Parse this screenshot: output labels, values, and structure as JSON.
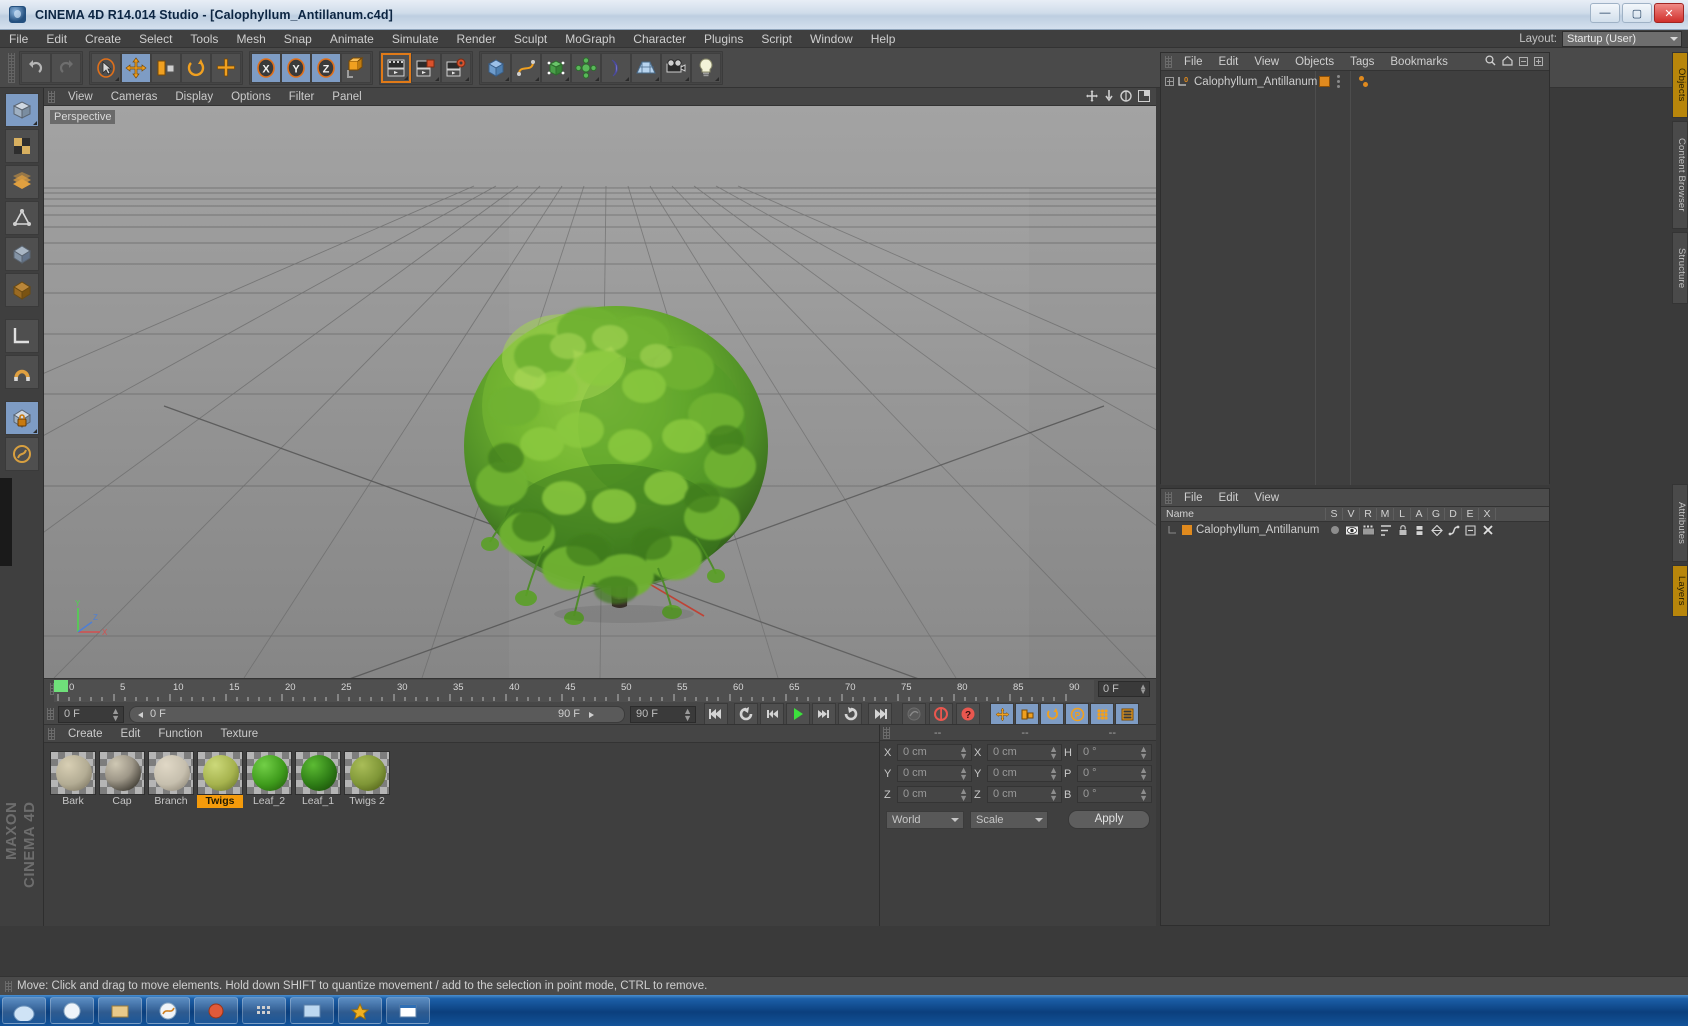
{
  "window": {
    "title": "CINEMA 4D R14.014 Studio - [Calophyllum_Antillanum.c4d]",
    "app_icon": "cinema4d-app-icon",
    "minimize": "—",
    "maximize": "▢",
    "close": "✕"
  },
  "menubar": {
    "items": [
      "File",
      "Edit",
      "Create",
      "Select",
      "Tools",
      "Mesh",
      "Snap",
      "Animate",
      "Simulate",
      "Render",
      "Sculpt",
      "MoGraph",
      "Character",
      "Plugins",
      "Script",
      "Window",
      "Help"
    ],
    "layout_label": "Layout:",
    "layout_value": "Startup (User)"
  },
  "toolbar": {
    "groups": [
      {
        "name": "history",
        "buttons": [
          {
            "icon": "undo-icon",
            "selected": false
          },
          {
            "icon": "redo-icon",
            "selected": false
          }
        ]
      },
      {
        "name": "tools",
        "buttons": [
          {
            "icon": "live-selection-icon",
            "selected": false
          },
          {
            "icon": "move-tool-icon",
            "selected": true
          },
          {
            "icon": "scale-tool-icon",
            "selected": false
          },
          {
            "icon": "rotate-tool-icon",
            "selected": false
          },
          {
            "icon": "add-tool-icon",
            "selected": false
          }
        ]
      },
      {
        "name": "axis-locks",
        "buttons": [
          {
            "icon": "x-axis-lock-icon",
            "selected": true
          },
          {
            "icon": "y-axis-lock-icon",
            "selected": true
          },
          {
            "icon": "z-axis-lock-icon",
            "selected": true
          },
          {
            "icon": "world-object-axis-icon",
            "selected": false
          }
        ]
      },
      {
        "name": "render",
        "buttons": [
          {
            "icon": "render-view-icon",
            "selected": false,
            "framed": true
          },
          {
            "icon": "render-region-icon",
            "selected": false
          },
          {
            "icon": "render-settings-icon",
            "selected": false
          }
        ]
      },
      {
        "name": "primitives",
        "buttons": [
          {
            "icon": "cube-primitive-icon",
            "selected": false
          },
          {
            "icon": "spline-pen-icon",
            "selected": false
          },
          {
            "icon": "nurbs-generator-icon",
            "selected": false
          },
          {
            "icon": "mograph-array-icon",
            "selected": false
          },
          {
            "icon": "deformer-bend-icon",
            "selected": false
          },
          {
            "icon": "scene-floor-icon",
            "selected": false
          },
          {
            "icon": "camera-icon",
            "selected": false
          },
          {
            "icon": "light-icon",
            "selected": false
          }
        ]
      }
    ]
  },
  "left_palette": {
    "buttons": [
      {
        "icon": "model-mode-icon",
        "selected": true
      },
      {
        "icon": "texture-mode-icon",
        "selected": false
      },
      {
        "icon": "points-mode-icon",
        "selected": false
      },
      {
        "icon": "edges-mode-icon",
        "selected": false
      },
      {
        "icon": "polygons-mode-icon",
        "selected": false
      },
      {
        "icon": "object-axis-mode-icon",
        "selected": false
      },
      {
        "icon": "workplane-icon",
        "selected": false
      },
      {
        "icon": "magnet-icon",
        "selected": false
      },
      {
        "icon": "enable-axis-icon",
        "selected": true
      },
      {
        "icon": "viewport-solo-icon",
        "selected": false
      }
    ],
    "brand_line1": "MAXON",
    "brand_line2": "CINEMA 4D"
  },
  "viewport": {
    "menu": [
      "View",
      "Cameras",
      "Display",
      "Options",
      "Filter",
      "Panel"
    ],
    "label": "Perspective",
    "corner_icons": [
      "pan-viewport-icon",
      "dolly-viewport-icon",
      "rotate-viewport-icon",
      "toggle-layout-icon"
    ],
    "axis": {
      "x": "X",
      "y": "Y",
      "z": "Z"
    }
  },
  "timeline": {
    "ticks": [
      "0",
      "5",
      "10",
      "15",
      "20",
      "25",
      "30",
      "35",
      "40",
      "45",
      "50",
      "55",
      "60",
      "65",
      "70",
      "75",
      "80",
      "85",
      "90"
    ],
    "current_frame_field": "0 F",
    "start_field": "0 F",
    "scrub_left": "0 F",
    "scrub_right": "90 F",
    "end_field": "90 F",
    "transport": [
      {
        "icon": "go-to-start-icon"
      },
      {
        "icon": "previous-key-icon"
      },
      {
        "icon": "step-back-icon"
      },
      {
        "icon": "play-icon"
      },
      {
        "icon": "step-forward-icon"
      },
      {
        "icon": "next-key-icon"
      },
      {
        "icon": "go-to-end-icon"
      }
    ],
    "record_tools": [
      {
        "icon": "autokey-icon",
        "selected": false
      },
      {
        "icon": "record-active-objects-icon",
        "selected": false
      },
      {
        "icon": "keyframe-selection-icon",
        "selected": false
      }
    ],
    "key_toggles": [
      {
        "icon": "key-position-icon",
        "selected": true
      },
      {
        "icon": "key-scale-icon",
        "selected": true
      },
      {
        "icon": "key-rotation-icon",
        "selected": true
      },
      {
        "icon": "key-parameter-icon",
        "selected": true
      },
      {
        "icon": "key-pla-icon",
        "selected": true
      },
      {
        "icon": "animation-layout-icon",
        "selected": true
      }
    ]
  },
  "material_manager": {
    "menu": [
      "Create",
      "Edit",
      "Function",
      "Texture"
    ],
    "materials": [
      {
        "name": "Bark",
        "color": "#b3ac94",
        "selected": false
      },
      {
        "name": "Cap",
        "color": "#9e9788",
        "selected": false
      },
      {
        "name": "Branch",
        "color": "#c6bfae",
        "selected": false
      },
      {
        "name": "Twigs",
        "color": "#a6b34e",
        "selected": true
      },
      {
        "name": "Leaf_2",
        "color": "#3f9c1c",
        "selected": false
      },
      {
        "name": "Leaf_1",
        "color": "#2e7d16",
        "selected": false
      },
      {
        "name": "Twigs 2",
        "color": "#7f9637",
        "selected": false
      }
    ]
  },
  "coordinates": {
    "headers": [
      "--",
      "--",
      "--"
    ],
    "rows": [
      {
        "label1": "X",
        "value1": "0 cm",
        "label2": "X",
        "value2": "0 cm",
        "label3": "H",
        "value3": "0 °"
      },
      {
        "label1": "Y",
        "value1": "0 cm",
        "label2": "Y",
        "value2": "0 cm",
        "label3": "P",
        "value3": "0 °"
      },
      {
        "label1": "Z",
        "value1": "0 cm",
        "label2": "Z",
        "value2": "0 cm",
        "label3": "B",
        "value3": "0 °"
      }
    ],
    "system_select": "World",
    "mode_select": "Scale",
    "apply_label": "Apply"
  },
  "object_manager": {
    "menu": [
      "File",
      "Edit",
      "View",
      "Objects",
      "Tags",
      "Bookmarks"
    ],
    "right_icons": [
      "search-icon",
      "home-icon",
      "collapse-icon",
      "expand-icon"
    ],
    "object_name": "Calophyllum_Antillanum",
    "layer_badge": "0"
  },
  "attribute_manager": {
    "menu": [
      "File",
      "Edit",
      "View"
    ],
    "columns": [
      "Name",
      "S",
      "V",
      "R",
      "M",
      "L",
      "A",
      "G",
      "D",
      "E",
      "X"
    ],
    "rows": [
      {
        "name": "Calophyllum_Antillanum",
        "color": "#e08a1e"
      }
    ]
  },
  "side_tabs": [
    {
      "label": "Objects",
      "accent": true
    },
    {
      "label": "Content Browser",
      "accent": false
    },
    {
      "label": "Structure",
      "accent": false
    },
    {
      "label": "Attributes",
      "accent": false
    },
    {
      "label": "Layers",
      "accent": true
    }
  ],
  "statusbar": {
    "text": "Move: Click and drag to move elements. Hold down SHIFT to quantize movement / add to the selection in point mode, CTRL to remove."
  },
  "taskbar": {
    "items": [
      "taskbar-item-1",
      "taskbar-item-2",
      "taskbar-item-3",
      "taskbar-item-4",
      "taskbar-item-5",
      "taskbar-item-6",
      "taskbar-item-7",
      "taskbar-item-8",
      "taskbar-item-9"
    ]
  }
}
